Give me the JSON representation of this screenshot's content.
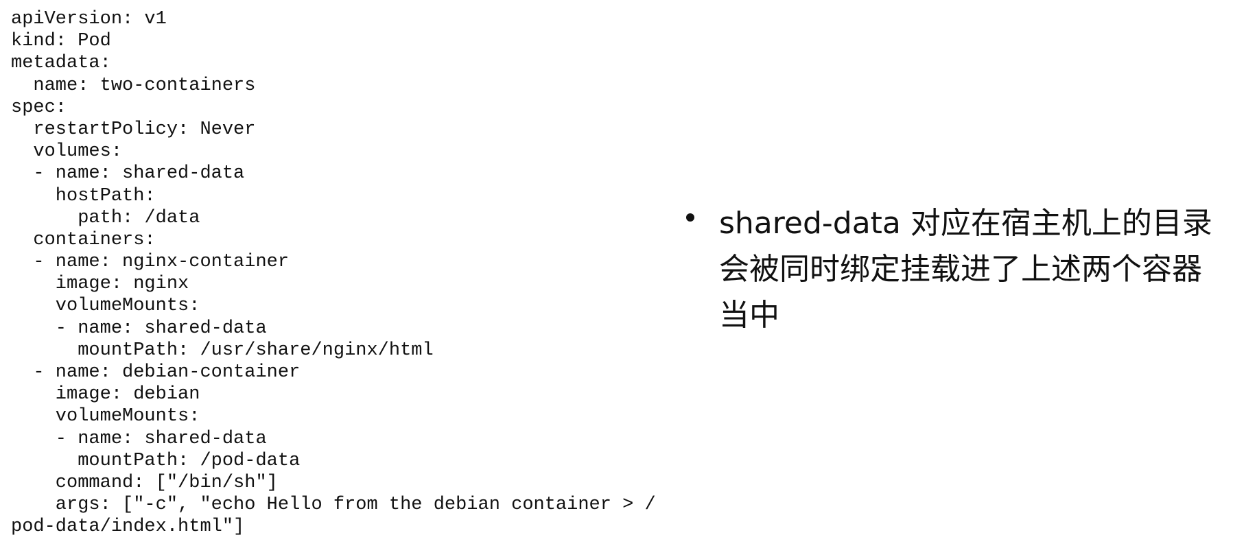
{
  "code": {
    "lines": [
      "apiVersion: v1",
      "kind: Pod",
      "metadata:",
      "  name: two-containers",
      "spec:",
      "  restartPolicy: Never",
      "  volumes:",
      "  - name: shared-data",
      "    hostPath:",
      "      path: /data",
      "  containers:",
      "  - name: nginx-container",
      "    image: nginx",
      "    volumeMounts:",
      "    - name: shared-data",
      "      mountPath: /usr/share/nginx/html",
      "  - name: debian-container",
      "    image: debian",
      "    volumeMounts:",
      "    - name: shared-data",
      "      mountPath: /pod-data",
      "    command: [\"/bin/sh\"]",
      "    args: [\"-c\", \"echo Hello from the debian container > /",
      "pod-data/index.html\"]"
    ]
  },
  "note": {
    "lines": [
      "shared-data 对应在宿主机上的目录",
      "会被同时绑定挂载进了上述两个容器",
      "当中"
    ]
  }
}
